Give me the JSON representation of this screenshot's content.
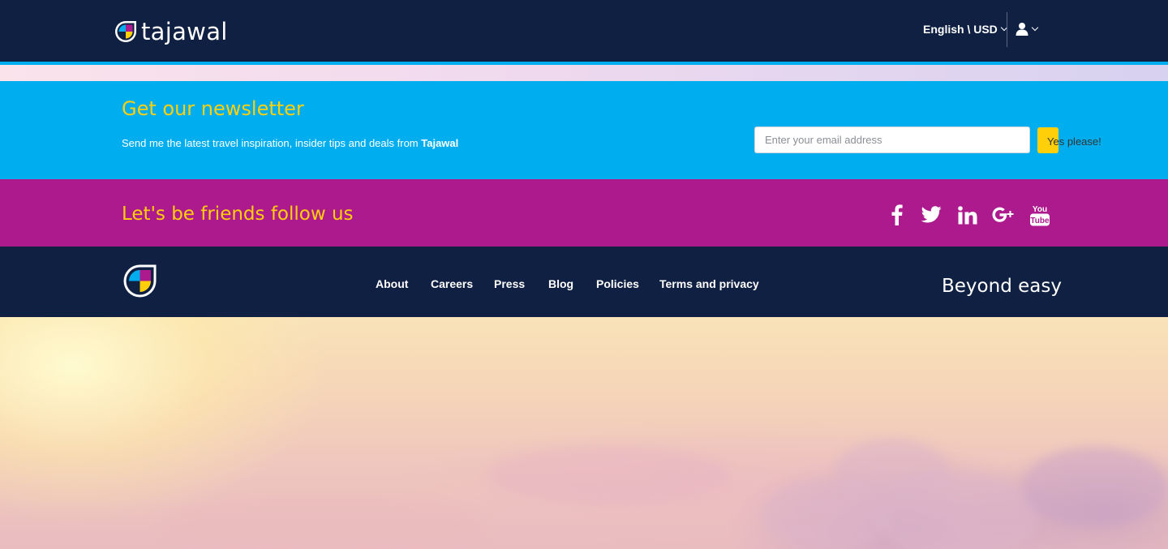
{
  "header": {
    "brand": "tajawal",
    "language_currency": "English \\ USD",
    "user_menu_icon": "user-icon"
  },
  "newsletter": {
    "title": "Get our newsletter",
    "description": "Send me the latest travel inspiration, insider tips and deals from ",
    "description_brand": "Tajawal",
    "email_placeholder": "Enter your email address",
    "email_value": "",
    "submit_label": "Yes please!"
  },
  "social": {
    "title": "Let's be friends follow us",
    "icons": [
      "facebook-icon",
      "twitter-icon",
      "linkedin-icon",
      "google-plus-icon",
      "youtube-icon"
    ]
  },
  "footer": {
    "links": [
      "About",
      "Careers",
      "Press",
      "Blog",
      "Policies",
      "Terms and privacy"
    ],
    "tagline": "Beyond easy"
  },
  "colors": {
    "navy": "#0f2043",
    "cyan": "#00aeef",
    "magenta": "#ac1a8e",
    "yellow": "#ffd00a"
  }
}
